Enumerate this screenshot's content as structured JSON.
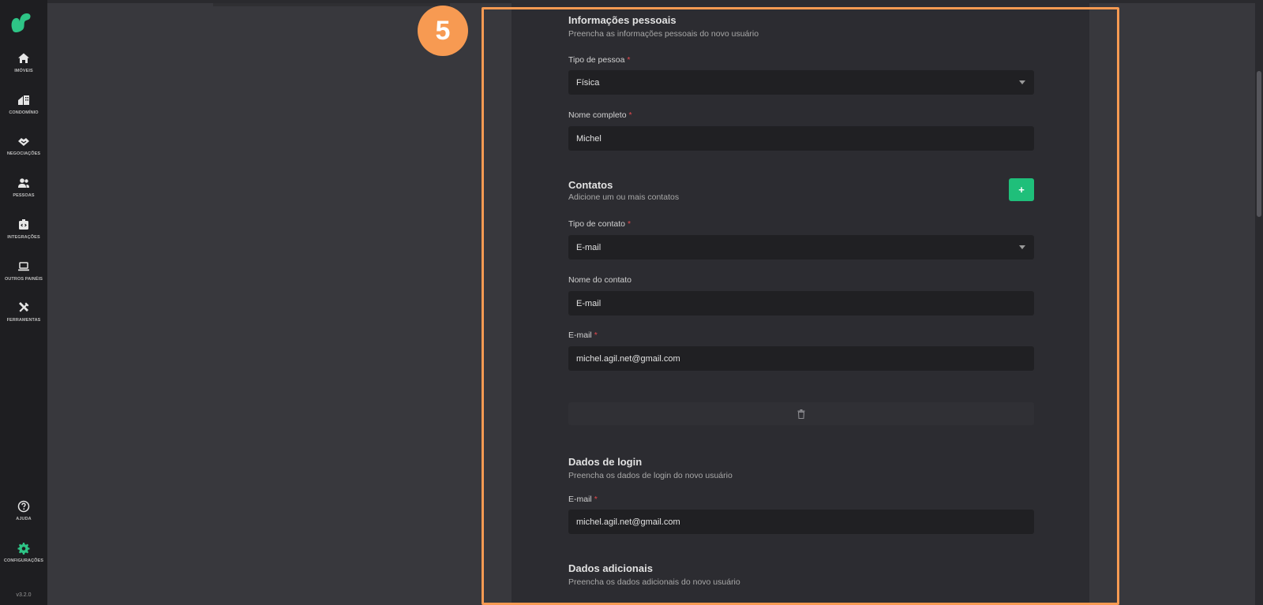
{
  "sidebar": {
    "items": [
      {
        "label": "IMÓVEIS",
        "icon": "home-icon"
      },
      {
        "label": "CONDOMÍNIO",
        "icon": "building-icon"
      },
      {
        "label": "NEGOCIAÇÕES",
        "icon": "handshake-icon"
      },
      {
        "label": "PESSOAS",
        "icon": "people-icon"
      },
      {
        "label": "INTEGRAÇÕES",
        "icon": "integration-icon"
      },
      {
        "label": "OUTROS PAINÉIS",
        "icon": "laptop-icon"
      },
      {
        "label": "FERRAMENTAS",
        "icon": "tools-icon"
      }
    ],
    "bottom": [
      {
        "label": "AJUDA",
        "icon": "help-icon"
      },
      {
        "label": "CONFIGURAÇÕES",
        "icon": "gear-icon"
      }
    ],
    "version": "v3.2.0"
  },
  "step": {
    "number": "5",
    "color": "#f79a52"
  },
  "sections": {
    "personal": {
      "title": "Informações pessoais",
      "subtitle": "Preencha as informações pessoais do novo usuário",
      "person_type_label": "Tipo de pessoa",
      "person_type_value": "Física",
      "full_name_label": "Nome completo",
      "full_name_value": "Michel"
    },
    "contacts": {
      "title": "Contatos",
      "subtitle": "Adicione um ou mais contatos",
      "add_label": "+",
      "contact_type_label": "Tipo de contato",
      "contact_type_value": "E-mail",
      "contact_name_label": "Nome do contato",
      "contact_name_value": "E-mail",
      "email_label": "E-mail",
      "email_value": "michel.agil.net@gmail.com"
    },
    "login": {
      "title": "Dados de login",
      "subtitle": "Preencha os dados de login do novo usuário",
      "email_label": "E-mail",
      "email_value": "michel.agil.net@gmail.com"
    },
    "additional": {
      "title": "Dados adicionais",
      "subtitle": "Preencha os dados adicionais do novo usuário"
    }
  },
  "colors": {
    "accent": "#1fbf7a",
    "required": "#e5484d",
    "highlight": "#f79a52"
  }
}
